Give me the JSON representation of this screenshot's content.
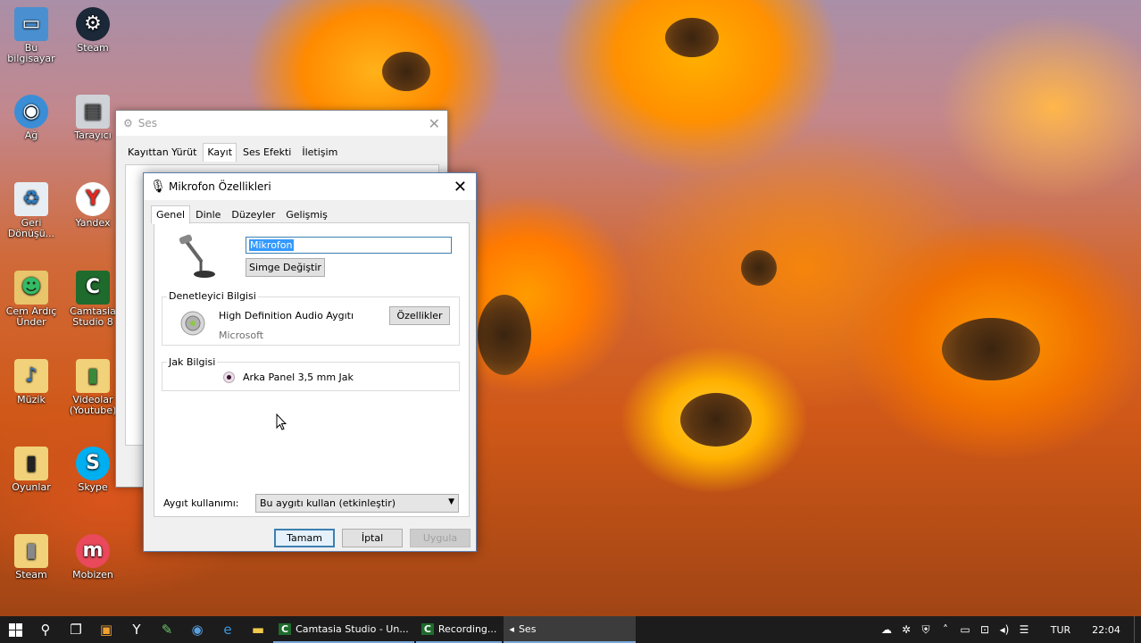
{
  "desktop": {
    "icons": [
      {
        "label": "Bu bilgisayar",
        "icon": "computer-icon"
      },
      {
        "label": "Steam",
        "icon": "steam-icon"
      },
      {
        "label": "Ağ",
        "icon": "network-icon"
      },
      {
        "label": "Tarayıcı",
        "icon": "scanner-icon"
      },
      {
        "label": "Geri Dönüşü...",
        "icon": "recycle-bin-icon"
      },
      {
        "label": "Yandex",
        "icon": "yandex-icon"
      },
      {
        "label": "Cem Ardıç Ünder",
        "icon": "user-folder-icon"
      },
      {
        "label": "Camtasia Studio 8",
        "icon": "camtasia-icon"
      },
      {
        "label": "Müzik",
        "icon": "music-folder-icon"
      },
      {
        "label": "Videolar (Youtube)",
        "icon": "video-folder-icon"
      },
      {
        "label": "Oyunlar",
        "icon": "games-folder-icon"
      },
      {
        "label": "Skype",
        "icon": "skype-icon"
      },
      {
        "label": "Steam",
        "icon": "steam-folder-icon"
      },
      {
        "label": "Mobizen",
        "icon": "mobizen-icon"
      }
    ]
  },
  "ses_window": {
    "title": "Ses",
    "tabs": [
      "Kayıttan Yürüt",
      "Kayıt",
      "Ses Efekti",
      "İletişim"
    ],
    "active_tab": "Kayıt"
  },
  "dialog": {
    "title": "Mikrofon Özellikleri",
    "tabs": [
      "Genel",
      "Dinle",
      "Düzeyler",
      "Gelişmiş"
    ],
    "active_tab": "Genel",
    "name_value": "Mikrofon",
    "change_icon_button": "Simge Değiştir",
    "controller": {
      "group_label": "Denetleyici Bilgisi",
      "device_name": "High Definition Audio Aygıtı",
      "manufacturer": "Microsoft",
      "properties_button": "Özellikler"
    },
    "jack": {
      "group_label": "Jak Bilgisi",
      "jack_name": "Arka Panel 3,5 mm Jak"
    },
    "device_usage": {
      "label": "Aygıt kullanımı:",
      "selected": "Bu aygıtı kullan (etkinleştir)"
    },
    "buttons": {
      "ok": "Tamam",
      "cancel": "İptal",
      "apply": "Uygula"
    }
  },
  "taskbar": {
    "apps": [
      {
        "label": "Camtasia Studio - Un...",
        "icon": "camtasia-icon"
      },
      {
        "label": "Recording...",
        "icon": "recording-icon"
      },
      {
        "label": "Ses",
        "icon": "speaker-icon"
      }
    ],
    "language": "TUR",
    "clock": "22:04"
  },
  "colors": {
    "accent": "#3c7fb1",
    "selection": "#3399ff",
    "taskbar": "#1c1c1c"
  }
}
